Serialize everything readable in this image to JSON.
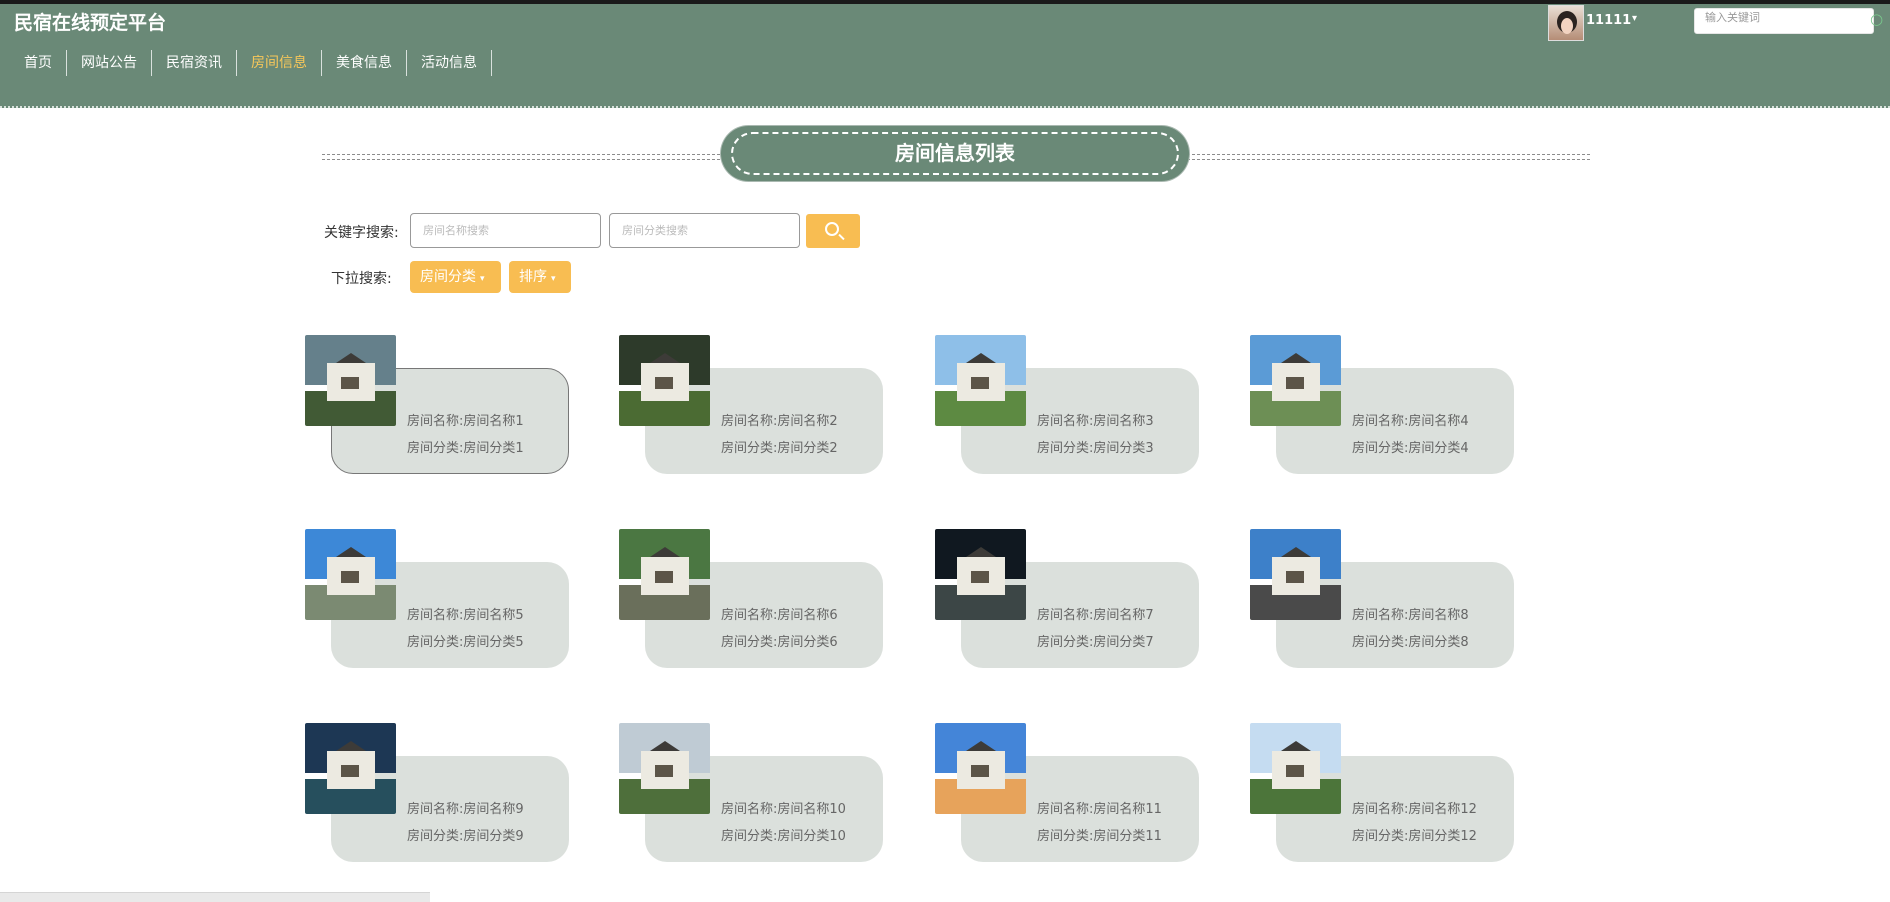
{
  "site": {
    "title": "民宿在线预定平台",
    "username": "11111",
    "search_placeholder": "输入关键词"
  },
  "nav": [
    {
      "label": "首页"
    },
    {
      "label": "网站公告"
    },
    {
      "label": "民宿资讯"
    },
    {
      "label": "房间信息"
    },
    {
      "label": "美食信息"
    },
    {
      "label": "活动信息"
    }
  ],
  "section_title": "房间信息列表",
  "filters": {
    "keyword_label": "关键字搜索:",
    "name_placeholder": "房间名称搜索",
    "category_placeholder": "房间分类搜索",
    "dropdown_label": "下拉搜索:",
    "category_button": "房间分类",
    "sort_button": "排序"
  },
  "rooms": [
    {
      "name": "房间名称:房间名称1",
      "category": "房间分类:房间分类1"
    },
    {
      "name": "房间名称:房间名称2",
      "category": "房间分类:房间分类2"
    },
    {
      "name": "房间名称:房间名称3",
      "category": "房间分类:房间分类3"
    },
    {
      "name": "房间名称:房间名称4",
      "category": "房间分类:房间分类4"
    },
    {
      "name": "房间名称:房间名称5",
      "category": "房间分类:房间分类5"
    },
    {
      "name": "房间名称:房间名称6",
      "category": "房间分类:房间分类6"
    },
    {
      "name": "房间名称:房间名称7",
      "category": "房间分类:房间分类7"
    },
    {
      "name": "房间名称:房间名称8",
      "category": "房间分类:房间分类8"
    },
    {
      "name": "房间名称:房间名称9",
      "category": "房间分类:房间分类9"
    },
    {
      "name": "房间名称:房间名称10",
      "category": "房间分类:房间分类10"
    },
    {
      "name": "房间名称:房间名称11",
      "category": "房间分类:房间分类11"
    },
    {
      "name": "房间名称:房间名称12",
      "category": "房间分类:房间分类12"
    }
  ],
  "colors": {
    "header": "#6a8977",
    "accent": "#f8bd52",
    "active_nav": "#f7c75a",
    "card": "#dbe0dc"
  }
}
